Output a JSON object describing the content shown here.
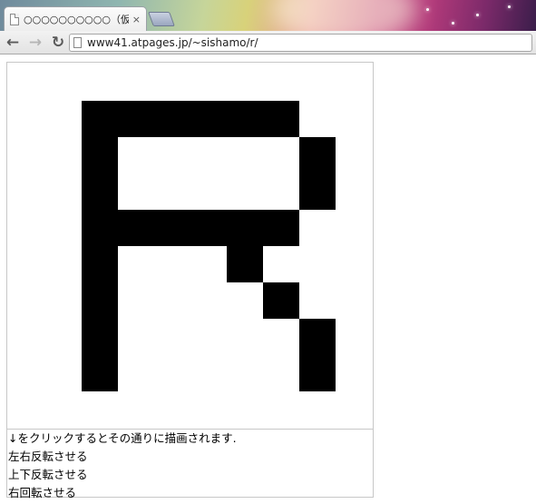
{
  "browser": {
    "tab_title": "○○○○○○○○○○（仮）",
    "tab_close": "×",
    "back_glyph": "←",
    "forward_glyph": "→",
    "reload_glyph": "↻",
    "url": "www41.atpages.jp/~sishamo/r/"
  },
  "pixel_grid": {
    "rows": 10,
    "cols": 10,
    "filled": [
      [
        1,
        1
      ],
      [
        1,
        2
      ],
      [
        1,
        3
      ],
      [
        1,
        4
      ],
      [
        1,
        5
      ],
      [
        1,
        6
      ],
      [
        2,
        1
      ],
      [
        2,
        7
      ],
      [
        3,
        1
      ],
      [
        3,
        7
      ],
      [
        4,
        1
      ],
      [
        4,
        2
      ],
      [
        4,
        3
      ],
      [
        4,
        4
      ],
      [
        4,
        5
      ],
      [
        4,
        6
      ],
      [
        5,
        1
      ],
      [
        5,
        5
      ],
      [
        6,
        1
      ],
      [
        6,
        6
      ],
      [
        7,
        1
      ],
      [
        7,
        7
      ],
      [
        8,
        1
      ],
      [
        8,
        7
      ]
    ]
  },
  "instructions": "↓をクリックするとその通りに描画されます.",
  "actions": [
    "左右反転させる",
    "上下反転させる",
    "右回転させる"
  ]
}
